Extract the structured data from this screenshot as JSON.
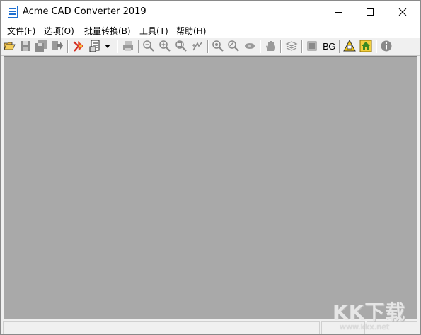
{
  "window": {
    "title": "Acme CAD Converter 2019",
    "controls": [
      "minimize",
      "maximize",
      "close"
    ]
  },
  "menubar": {
    "items": [
      "文件(F)",
      "选项(O)",
      "批量转换(B)",
      "工具(T)",
      "帮助(H)"
    ]
  },
  "toolbar": {
    "items": [
      {
        "icon": "open-folder-icon"
      },
      {
        "icon": "save-icon"
      },
      {
        "icon": "save-all-icon"
      },
      {
        "icon": "export-icon"
      },
      {
        "icon": "convert-pdf-icon"
      },
      {
        "icon": "print-preview-icon"
      },
      {
        "icon": "dropdown-arrow-icon"
      },
      {
        "icon": "print-icon"
      },
      {
        "icon": "zoom-out-icon"
      },
      {
        "icon": "zoom-in-icon"
      },
      {
        "icon": "zoom-window-icon"
      },
      {
        "icon": "pan-icon"
      },
      {
        "icon": "zoom-extents-icon"
      },
      {
        "icon": "zoom-realtime-icon"
      },
      {
        "icon": "view-icon"
      },
      {
        "icon": "hand-icon"
      },
      {
        "icon": "layers-icon"
      },
      {
        "icon": "raster-icon"
      },
      {
        "icon": "bg-label",
        "text": "BG"
      },
      {
        "icon": "measure-icon"
      },
      {
        "icon": "home-icon"
      },
      {
        "icon": "info-icon"
      }
    ],
    "bg_label": "BG"
  },
  "workspace": {
    "color": "#a9a9a9"
  },
  "watermark": {
    "text": "KK下载",
    "url": "www.kkx.net"
  },
  "colors": {
    "accent_icon": "#1e6fd0",
    "pdf_red": "#d22b20",
    "home_green": "#3a8a22",
    "warning_yellow": "#f1c40f"
  }
}
